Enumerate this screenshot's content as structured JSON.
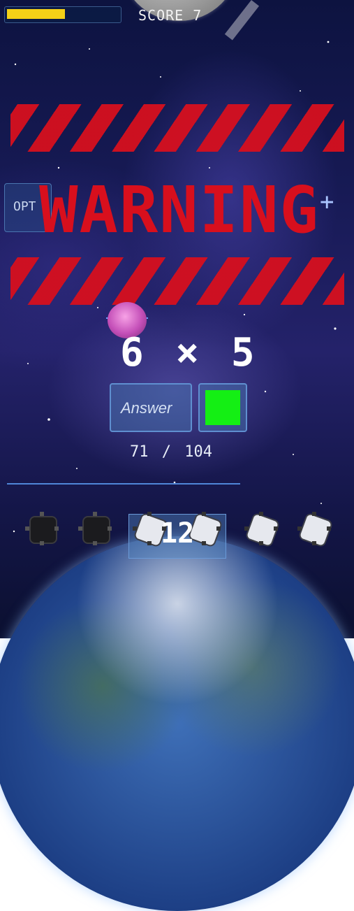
{
  "hud": {
    "health_fraction": 0.52,
    "score_text": "SCORE 7"
  },
  "warning": {
    "text": "WARNING"
  },
  "options_button": {
    "label": "OPT"
  },
  "plus_icon": "plus-icon",
  "question": {
    "text": "6 × 5"
  },
  "answer_input": {
    "placeholder": "Answer"
  },
  "submit_button": {
    "color": "#14ef14"
  },
  "progress": {
    "current": "71",
    "separator": "/",
    "total": "104"
  },
  "fleet": {
    "count": "12",
    "ships": [
      "dark",
      "dark",
      "light",
      "light",
      "light",
      "light"
    ]
  },
  "colors": {
    "warning_red": "#d60f1e",
    "health_yellow": "#f4d117",
    "accent_blue": "#4f86d8"
  }
}
